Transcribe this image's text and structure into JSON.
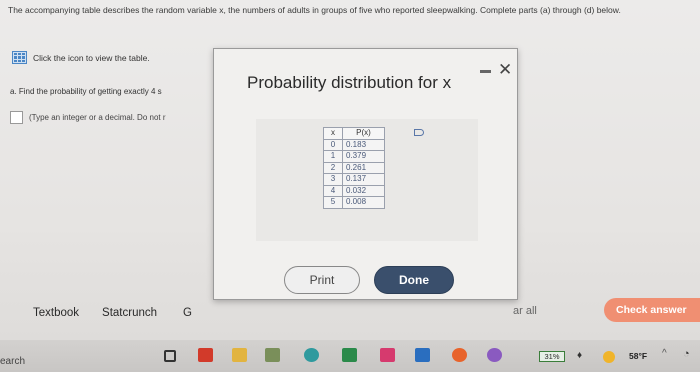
{
  "intro": {
    "text": "The accompanying table describes the random variable x, the numbers of adults in groups of five who reported sleepwalking. Complete parts (a) through (d) below."
  },
  "table_link": {
    "label": "Click the icon to view the table."
  },
  "question_a": {
    "text": "a. Find the probability of getting exactly 4 s",
    "hint": "(Type an integer or a decimal. Do not r"
  },
  "modal": {
    "title": "Probability distribution for x",
    "table": {
      "headers": [
        "x",
        "P(x)"
      ],
      "rows": [
        [
          "0",
          "0.183"
        ],
        [
          "1",
          "0.379"
        ],
        [
          "2",
          "0.261"
        ],
        [
          "3",
          "0.137"
        ],
        [
          "4",
          "0.032"
        ],
        [
          "5",
          "0.008"
        ]
      ]
    },
    "print_label": "Print",
    "done_label": "Done",
    "minimize_glyph": "—",
    "close_glyph": "✕"
  },
  "bottom": {
    "textbook": "Textbook",
    "statcrunch": "Statcrunch",
    "cut_label": "G",
    "clear_all": "ar all",
    "check_answer": "Check answer"
  },
  "taskbar": {
    "search": "earch",
    "battery": "31%",
    "temperature": "58°F",
    "chevron": "^",
    "icons": [
      "task-view-icon",
      "office-icon",
      "file-explorer-icon",
      "photos-icon",
      "edge-icon",
      "l-app-icon",
      "mail-icon",
      "teams-icon",
      "firefox-icon",
      "settings-icon"
    ]
  },
  "colors": {
    "accent_button": "#3a4f6c",
    "check_answer": "#f08f72",
    "link_icon": "#4a86c5"
  }
}
